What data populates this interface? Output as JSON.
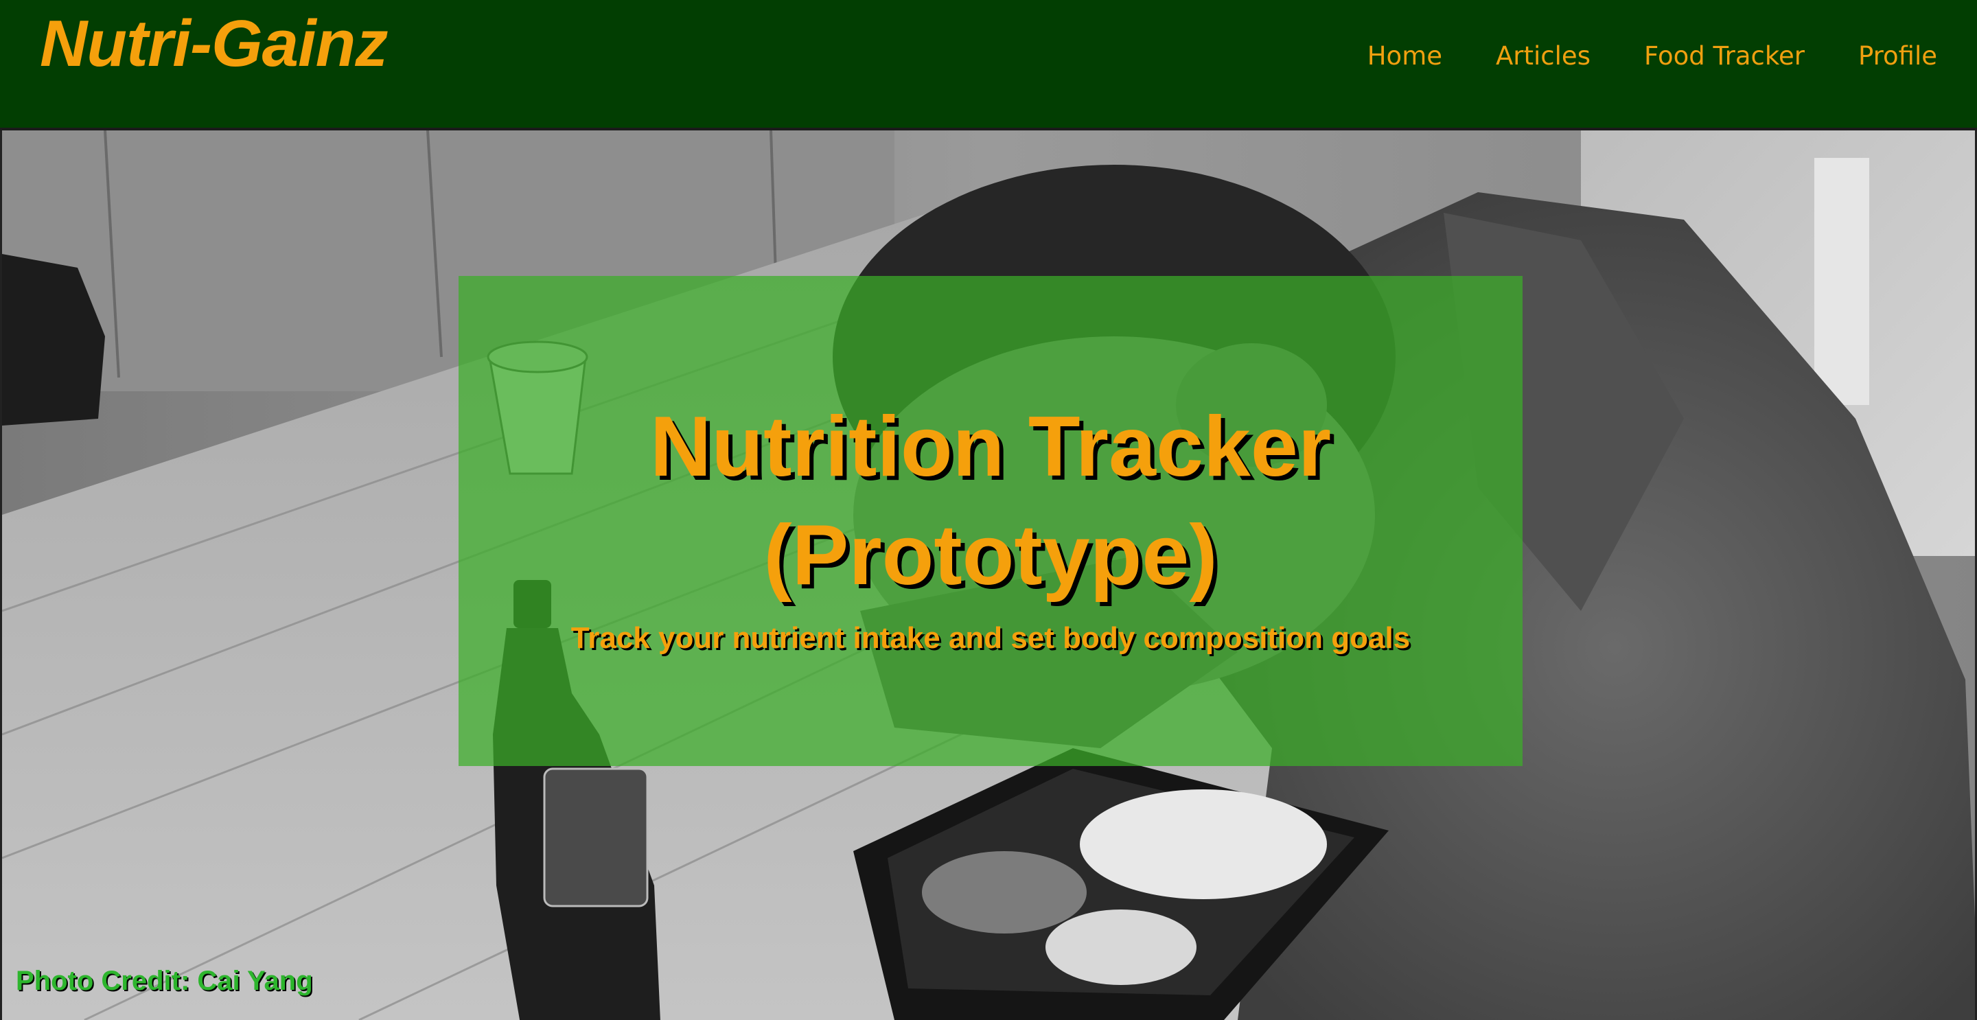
{
  "header": {
    "brand": "Nutri-Gainz",
    "nav": [
      {
        "label": "Home"
      },
      {
        "label": "Articles"
      },
      {
        "label": "Food Tracker"
      },
      {
        "label": "Profile"
      }
    ]
  },
  "hero": {
    "title_line1": "Nutrition Tracker",
    "title_line2": "(Prototype)",
    "subtitle": "Track your nutrient intake and set body composition goals",
    "photo_credit": "Photo Credit: Cai Yang"
  },
  "colors": {
    "nav_background": "#023e02",
    "accent": "#f5a00c",
    "panel_overlay": "#3bae28",
    "credit_text": "#2db52d"
  }
}
